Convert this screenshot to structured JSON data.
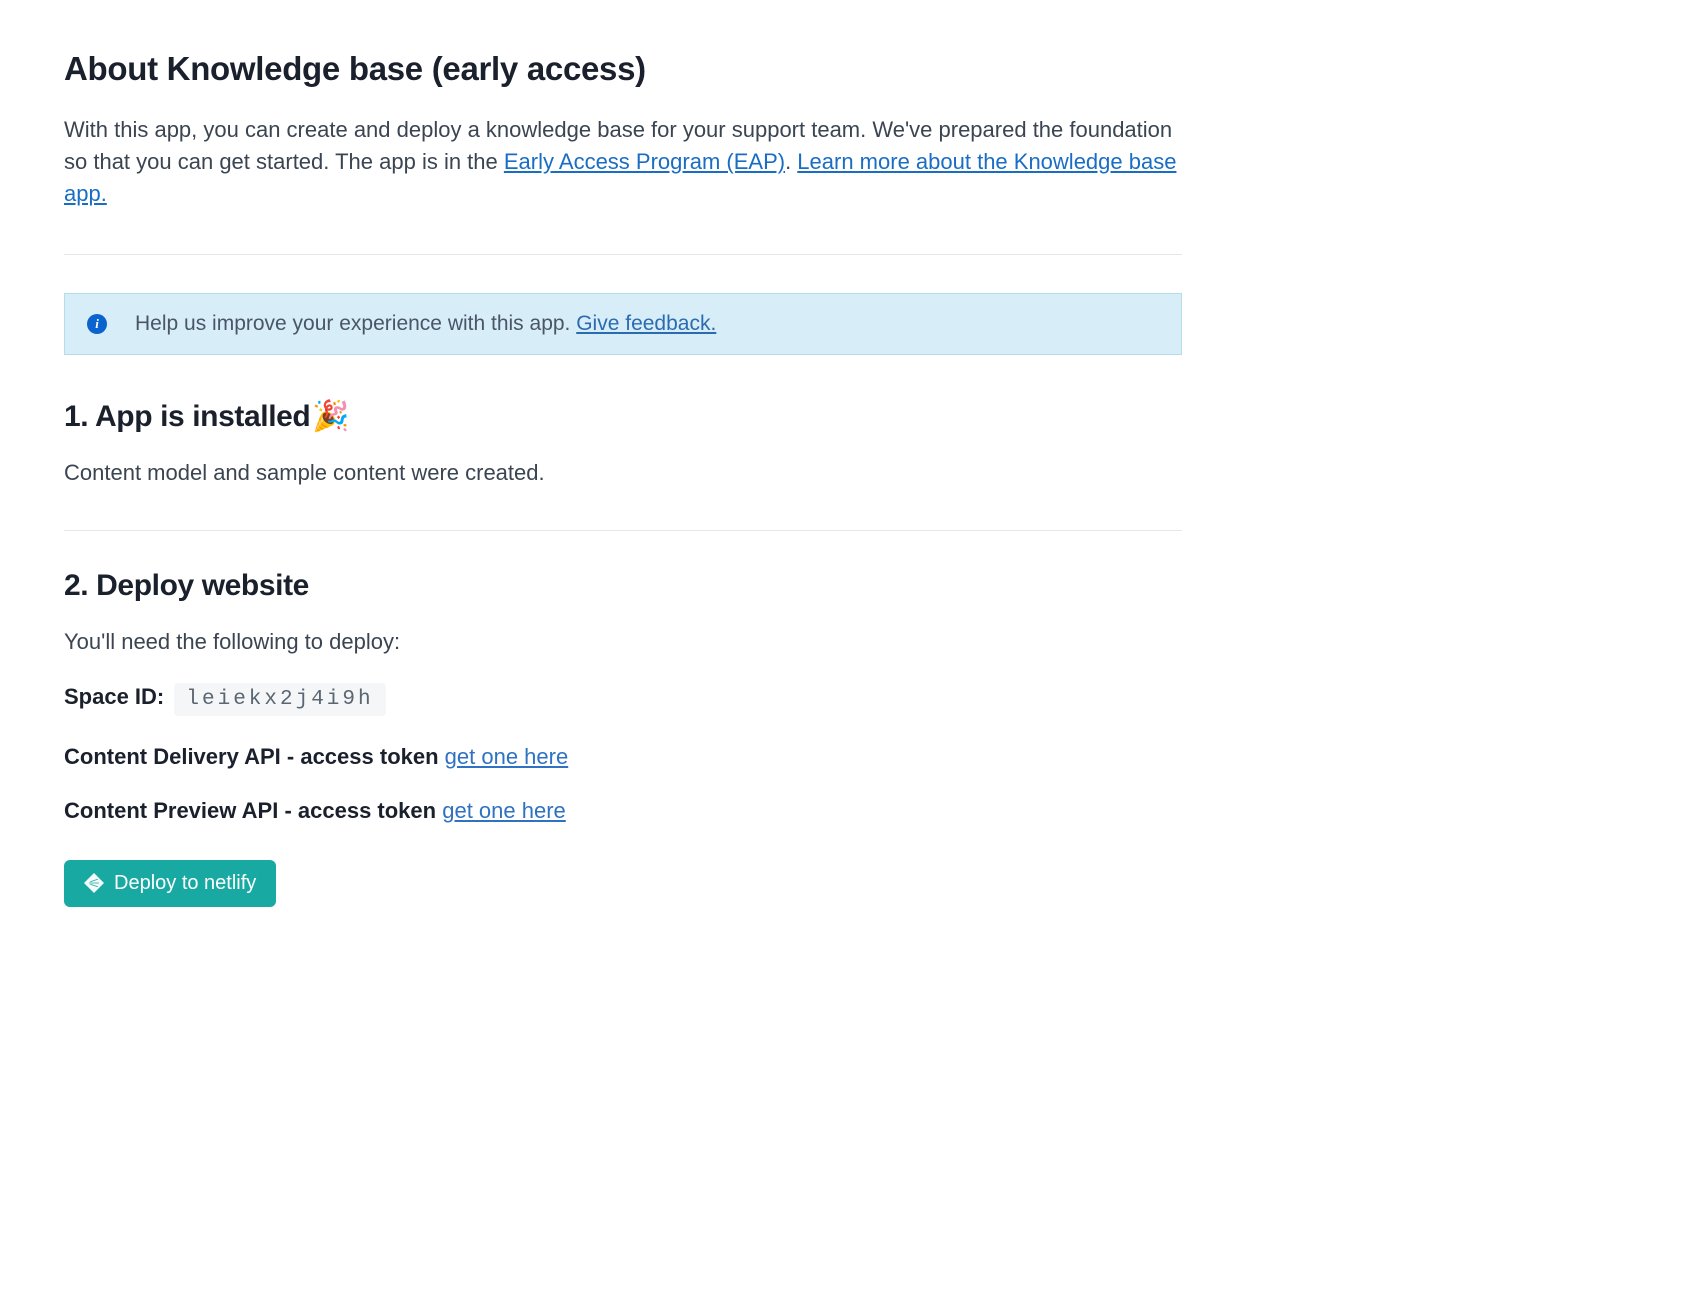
{
  "header": {
    "title": "About Knowledge base (early access)",
    "intro_prefix": "With this app, you can create and deploy a knowledge base for your support team. We've prepared the foundation so that you can get started. The app is in the ",
    "eap_link": "Early Access Program (EAP)",
    "intro_period": ". ",
    "learn_more_link": "Learn more about the Knowledge base app."
  },
  "banner": {
    "text": "Help us improve your experience with this app. ",
    "feedback_link": "Give feedback."
  },
  "section1": {
    "title": "1. App is installed",
    "emoji": "🎉",
    "body": "Content model and sample content were created."
  },
  "section2": {
    "title": "2. Deploy website",
    "intro": "You'll need the following to deploy:",
    "space_id_label": "Space ID:",
    "space_id_value": "leiekx2j4i9h",
    "cda_label": "Content Delivery API - access token",
    "cda_link": "get one here",
    "cpa_label": "Content Preview API - access token",
    "cpa_link": "get one here",
    "deploy_word": "Deploy",
    "deploy_to": " to netlify"
  }
}
